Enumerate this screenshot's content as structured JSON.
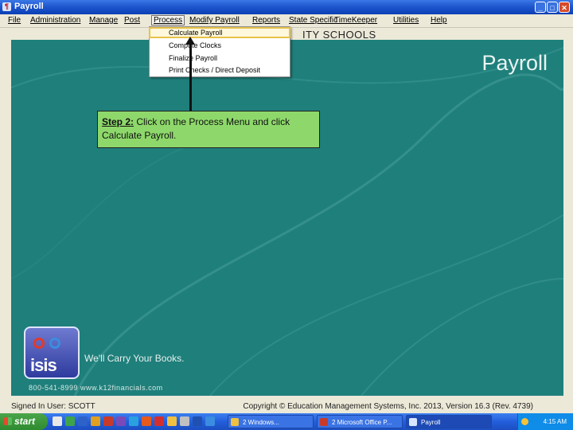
{
  "window": {
    "title": "Payroll",
    "min_label": "_",
    "max_label": "□",
    "close_label": "✕"
  },
  "menu": {
    "items": [
      "File",
      "Administration",
      "Manage",
      "Post",
      "Process",
      "Modify Payroll",
      "Reports",
      "State Specific",
      "TimeKeeper",
      "Utilities",
      "Help"
    ],
    "active": "Process"
  },
  "district_name": "ITY SCHOOLS",
  "dropdown": {
    "items": [
      "Calculate Payroll",
      "Compute Clocks",
      "Finalize Payroll",
      "Print Checks / Direct Deposit"
    ],
    "highlighted": "Calculate Payroll"
  },
  "brand": {
    "title": "Payroll",
    "logo_text": "isis",
    "slogan": "We'll Carry Your Books.",
    "contact": "800-541-8999    www.k12financials.com"
  },
  "callout": {
    "step": "Step 2:",
    "text": " Click on the Process Menu and click Calculate Payroll."
  },
  "status": {
    "signed_in": "Signed In User: SCOTT",
    "copyright": "Copyright © Education Management Systems, Inc. 2013, Version 16.3 (Rev. 4739)"
  },
  "taskbar": {
    "start_label": "start",
    "tasks": [
      "2 Windows...",
      "2 Microsoft Office P...",
      "Payroll"
    ],
    "clock": "4:15 AM"
  },
  "colors": {
    "background": "#1f7f7b",
    "callout": "#8ed86b",
    "titlebar": "#1f57cf"
  }
}
